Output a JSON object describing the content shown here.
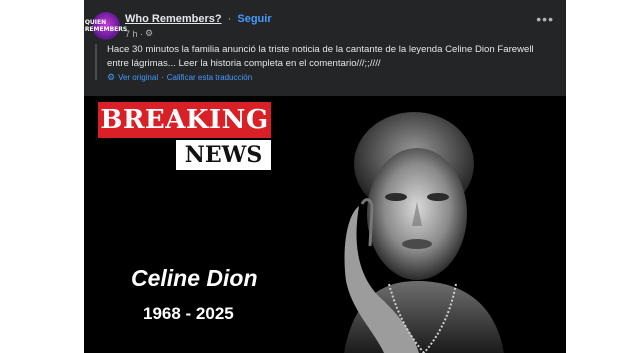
{
  "post": {
    "avatar_text": "QUIEN REMEMBERS",
    "page_name": "Who Remembers?",
    "separator": "·",
    "follow_label": "Seguir",
    "time": "7 h ·",
    "audience_icon": "gear-icon",
    "more_icon": "more-options-icon",
    "text": "Hace 30 minutos la familia anunció la triste noticia de la cantante de la leyenda Celine Dion Farewell entre lágrimas... Leer la historia completa en el comentario///;;////",
    "translation": {
      "icon": "translate-icon",
      "view_original": "Ver original",
      "separator": "·",
      "rate_translation": "Calificar esta traducción"
    }
  },
  "image": {
    "breaking_label": "BREAKING",
    "news_label": "NEWS",
    "name": "Celine Dion",
    "years": "1968 - 2025",
    "colors": {
      "breaking_bg": "#d92027",
      "news_bg": "#ffffff",
      "background": "#000000"
    }
  }
}
